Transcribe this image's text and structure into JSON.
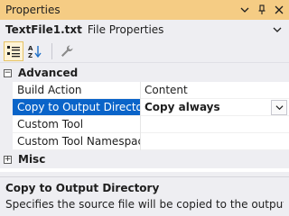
{
  "window": {
    "title": "Properties",
    "accent_color": "#f5cc84"
  },
  "object": {
    "name": "TextFile1.txt",
    "type": "File Properties"
  },
  "toolbar": {
    "categorized_icon": "categorized-view-icon",
    "alphabetical_icon": "alphabetical-sort-icon",
    "property_pages_icon": "wrench-icon"
  },
  "grid": {
    "categories": [
      {
        "label": "Advanced",
        "expanded": true,
        "expander": "−",
        "properties": [
          {
            "name": "Build Action",
            "value": "Content"
          },
          {
            "name": "Copy to Output Directory",
            "value": "Copy always",
            "selected": true
          },
          {
            "name": "Custom Tool",
            "value": ""
          },
          {
            "name": "Custom Tool Namespace",
            "value": ""
          }
        ]
      },
      {
        "label": "Misc",
        "expanded": false,
        "expander": "+"
      }
    ],
    "selection_color": "#0a64c9"
  },
  "description": {
    "title": "Copy to Output Directory",
    "text": "Specifies the source file will be copied to the output dire…"
  }
}
